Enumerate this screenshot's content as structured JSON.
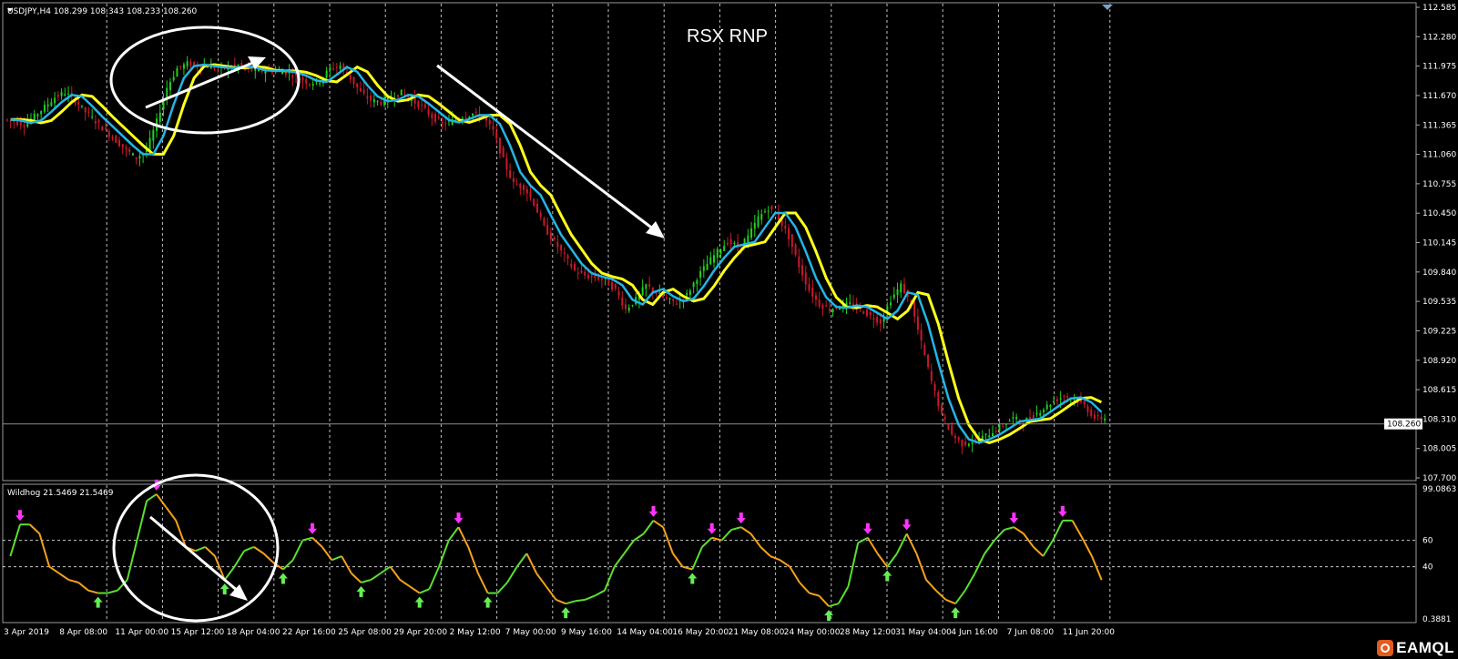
{
  "main_chart": {
    "symbol_info": "USDJPY,H4  108.299 108.343 108.233 108.260",
    "annotation_title": "RSX RNP",
    "current_price_label": "108.260",
    "price_axis_labels": [
      "112.585",
      "112.280",
      "111.975",
      "111.670",
      "111.365",
      "111.060",
      "110.755",
      "110.450",
      "110.145",
      "109.840",
      "109.535",
      "109.225",
      "108.920",
      "108.615",
      "108.310",
      "108.005",
      "107.700"
    ],
    "price_range": [
      107.7,
      112.585
    ],
    "current_price": 108.26,
    "price_series": [
      111.42,
      111.4,
      111.37,
      111.45,
      111.55,
      111.65,
      111.7,
      111.62,
      111.5,
      111.4,
      111.3,
      111.2,
      111.1,
      111.02,
      111.1,
      111.4,
      111.75,
      111.95,
      112.0,
      111.98,
      111.97,
      111.95,
      111.96,
      111.98,
      111.94,
      111.92,
      111.93,
      111.92,
      111.9,
      111.85,
      111.8,
      111.82,
      111.95,
      111.98,
      111.85,
      111.7,
      111.62,
      111.6,
      111.65,
      111.7,
      111.62,
      111.55,
      111.45,
      111.38,
      111.4,
      111.45,
      111.48,
      111.45,
      111.3,
      111.0,
      110.75,
      110.72,
      110.55,
      110.3,
      110.15,
      110.0,
      109.85,
      109.8,
      109.78,
      109.75,
      109.65,
      109.45,
      109.55,
      109.7,
      109.62,
      109.55,
      109.52,
      109.6,
      109.78,
      109.92,
      110.05,
      110.15,
      110.1,
      110.2,
      110.4,
      110.5,
      110.4,
      110.2,
      109.9,
      109.65,
      109.5,
      109.45,
      109.48,
      109.5,
      109.45,
      109.38,
      109.32,
      109.55,
      109.7,
      109.5,
      109.1,
      108.7,
      108.35,
      108.15,
      108.05,
      108.08,
      108.12,
      108.18,
      108.25,
      108.32,
      108.28,
      108.35,
      108.42,
      108.5,
      108.55,
      108.52,
      108.45,
      108.32
    ],
    "colors": {
      "bull": "#1fd11f",
      "bear": "#c9192a",
      "ma_fast": "#22b5e6",
      "ma_slow": "#ffff1a",
      "grid": "#ffffff",
      "pink": "#e0207a"
    }
  },
  "indicator": {
    "title": "Wildhog 21.5469 21.5469",
    "axis_labels": {
      "top": "99.0863",
      "l60": "60",
      "l40": "40",
      "bottom": "0.3881"
    },
    "range": [
      0.3881,
      99.0863
    ],
    "series": [
      48,
      72,
      72,
      65,
      40,
      35,
      30,
      28,
      22,
      20,
      20,
      22,
      30,
      60,
      90,
      95,
      85,
      75,
      55,
      52,
      55,
      48,
      30,
      40,
      52,
      55,
      50,
      43,
      38,
      45,
      60,
      62,
      55,
      45,
      48,
      35,
      28,
      30,
      35,
      40,
      30,
      25,
      20,
      23,
      40,
      60,
      70,
      55,
      35,
      20,
      20,
      28,
      40,
      50,
      35,
      25,
      15,
      12,
      14,
      15,
      18,
      22,
      40,
      50,
      60,
      65,
      75,
      70,
      50,
      40,
      38,
      55,
      62,
      60,
      68,
      70,
      65,
      55,
      48,
      45,
      40,
      28,
      20,
      18,
      10,
      12,
      25,
      58,
      62,
      50,
      40,
      50,
      65,
      50,
      30,
      22,
      15,
      12,
      22,
      35,
      50,
      60,
      68,
      70,
      65,
      55,
      48,
      60,
      75,
      75,
      62,
      48,
      30
    ]
  },
  "time_axis_labels": [
    "3 Apr 2019",
    "8 Apr 08:00",
    "11 Apr 00:00",
    "15 Apr 12:00",
    "18 Apr 04:00",
    "22 Apr 16:00",
    "25 Apr 08:00",
    "29 Apr 20:00",
    "2 May 12:00",
    "7 May 00:00",
    "9 May 16:00",
    "14 May 04:00",
    "16 May 20:00",
    "21 May 08:00",
    "24 May 00:00",
    "28 May 12:00",
    "31 May 04:00",
    "4 Jun 16:00",
    "7 Jun 08:00",
    "11 Jun 20:00"
  ],
  "watermark": {
    "text": "EAMQL"
  }
}
